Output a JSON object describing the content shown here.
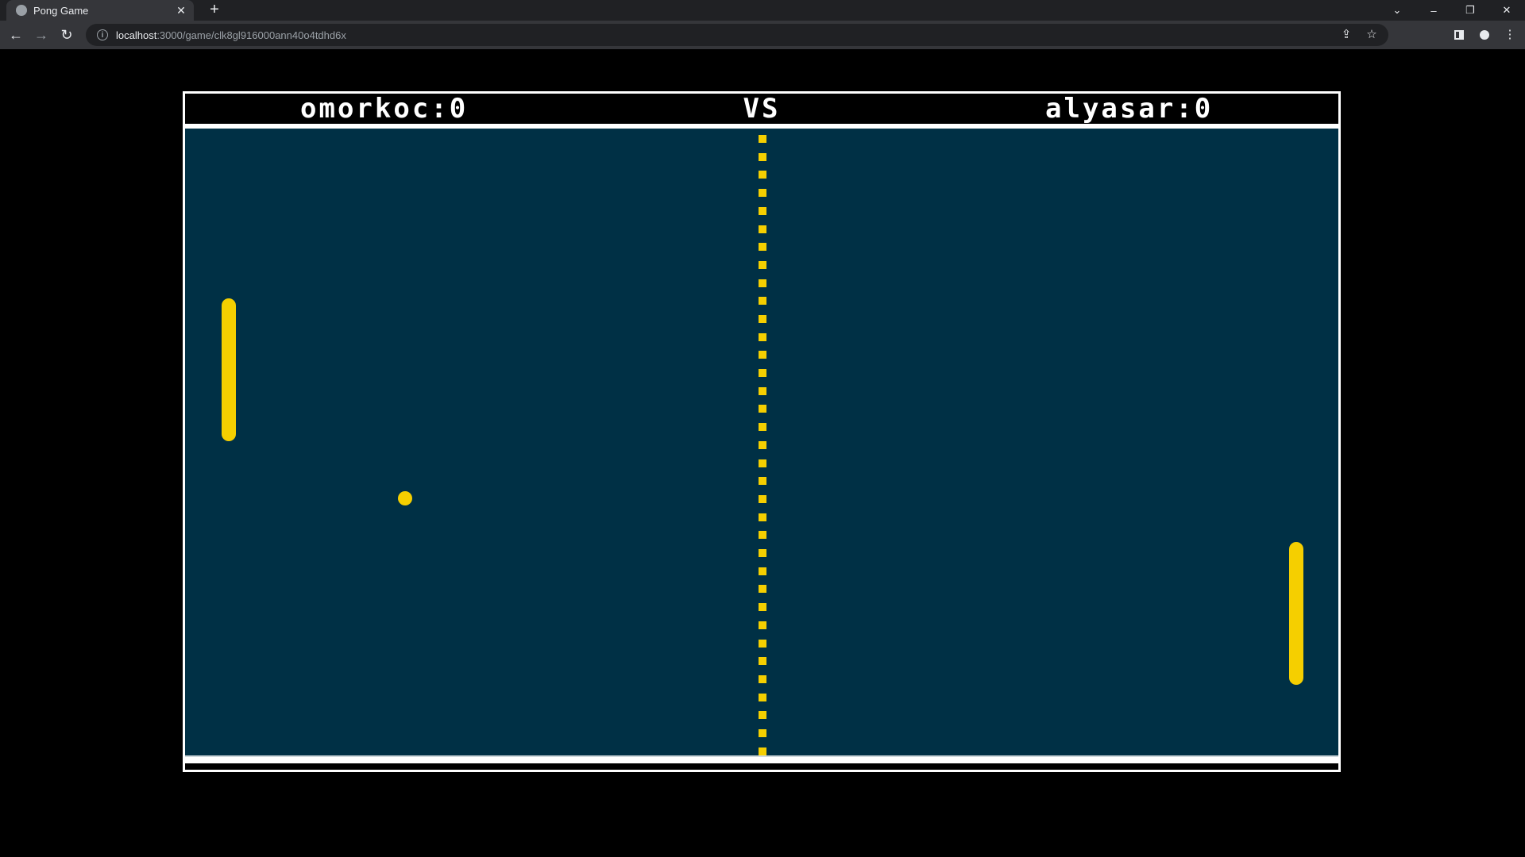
{
  "browser": {
    "tab": {
      "title": "Pong Game",
      "favicon": "globe-icon",
      "close": "✕"
    },
    "new_tab": "+",
    "address": {
      "host": "localhost",
      "path": ":3000/game/clk8gl916000ann40o4tdhd6x"
    },
    "window_controls": {
      "dropdown": "⌄",
      "minimize": "–",
      "restore": "❐",
      "close": "✕"
    }
  },
  "game": {
    "player_left": {
      "name": "omorkoc",
      "score": 0,
      "label": "omorkoc:0"
    },
    "vs_label": "VS",
    "player_right": {
      "name": "alyasar",
      "score": 0,
      "label": "alyasar:0"
    }
  },
  "colors": {
    "field": "#003045",
    "accent": "#f5cf00",
    "border": "#ffffff"
  }
}
